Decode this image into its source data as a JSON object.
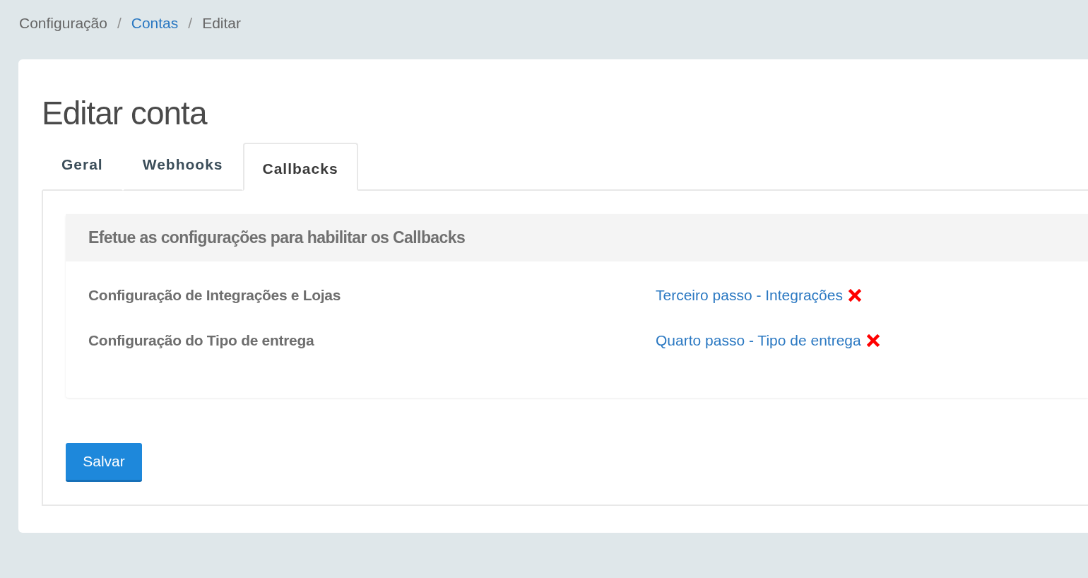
{
  "breadcrumb": [
    {
      "label": "Configuração",
      "link": false
    },
    {
      "label": "Contas",
      "link": true
    },
    {
      "label": "Editar",
      "link": false
    }
  ],
  "breadcrumb_separator": "/",
  "title": "Editar conta",
  "tabs": [
    {
      "label": "Geral",
      "selected": false
    },
    {
      "label": "Webhooks",
      "selected": false
    },
    {
      "label": "Callbacks",
      "selected": true
    }
  ],
  "panel": {
    "heading": "Efetue as configurações para habilitar os Callbacks",
    "rows": [
      {
        "label": "Configuração de Integrações e Lojas",
        "link": "Terceiro passo - Integrações",
        "done": false
      },
      {
        "label": "Configuração do Tipo de entrega",
        "link": "Quarto passo - Tipo de entrega",
        "done": false
      }
    ]
  },
  "save_button": "Salvar"
}
